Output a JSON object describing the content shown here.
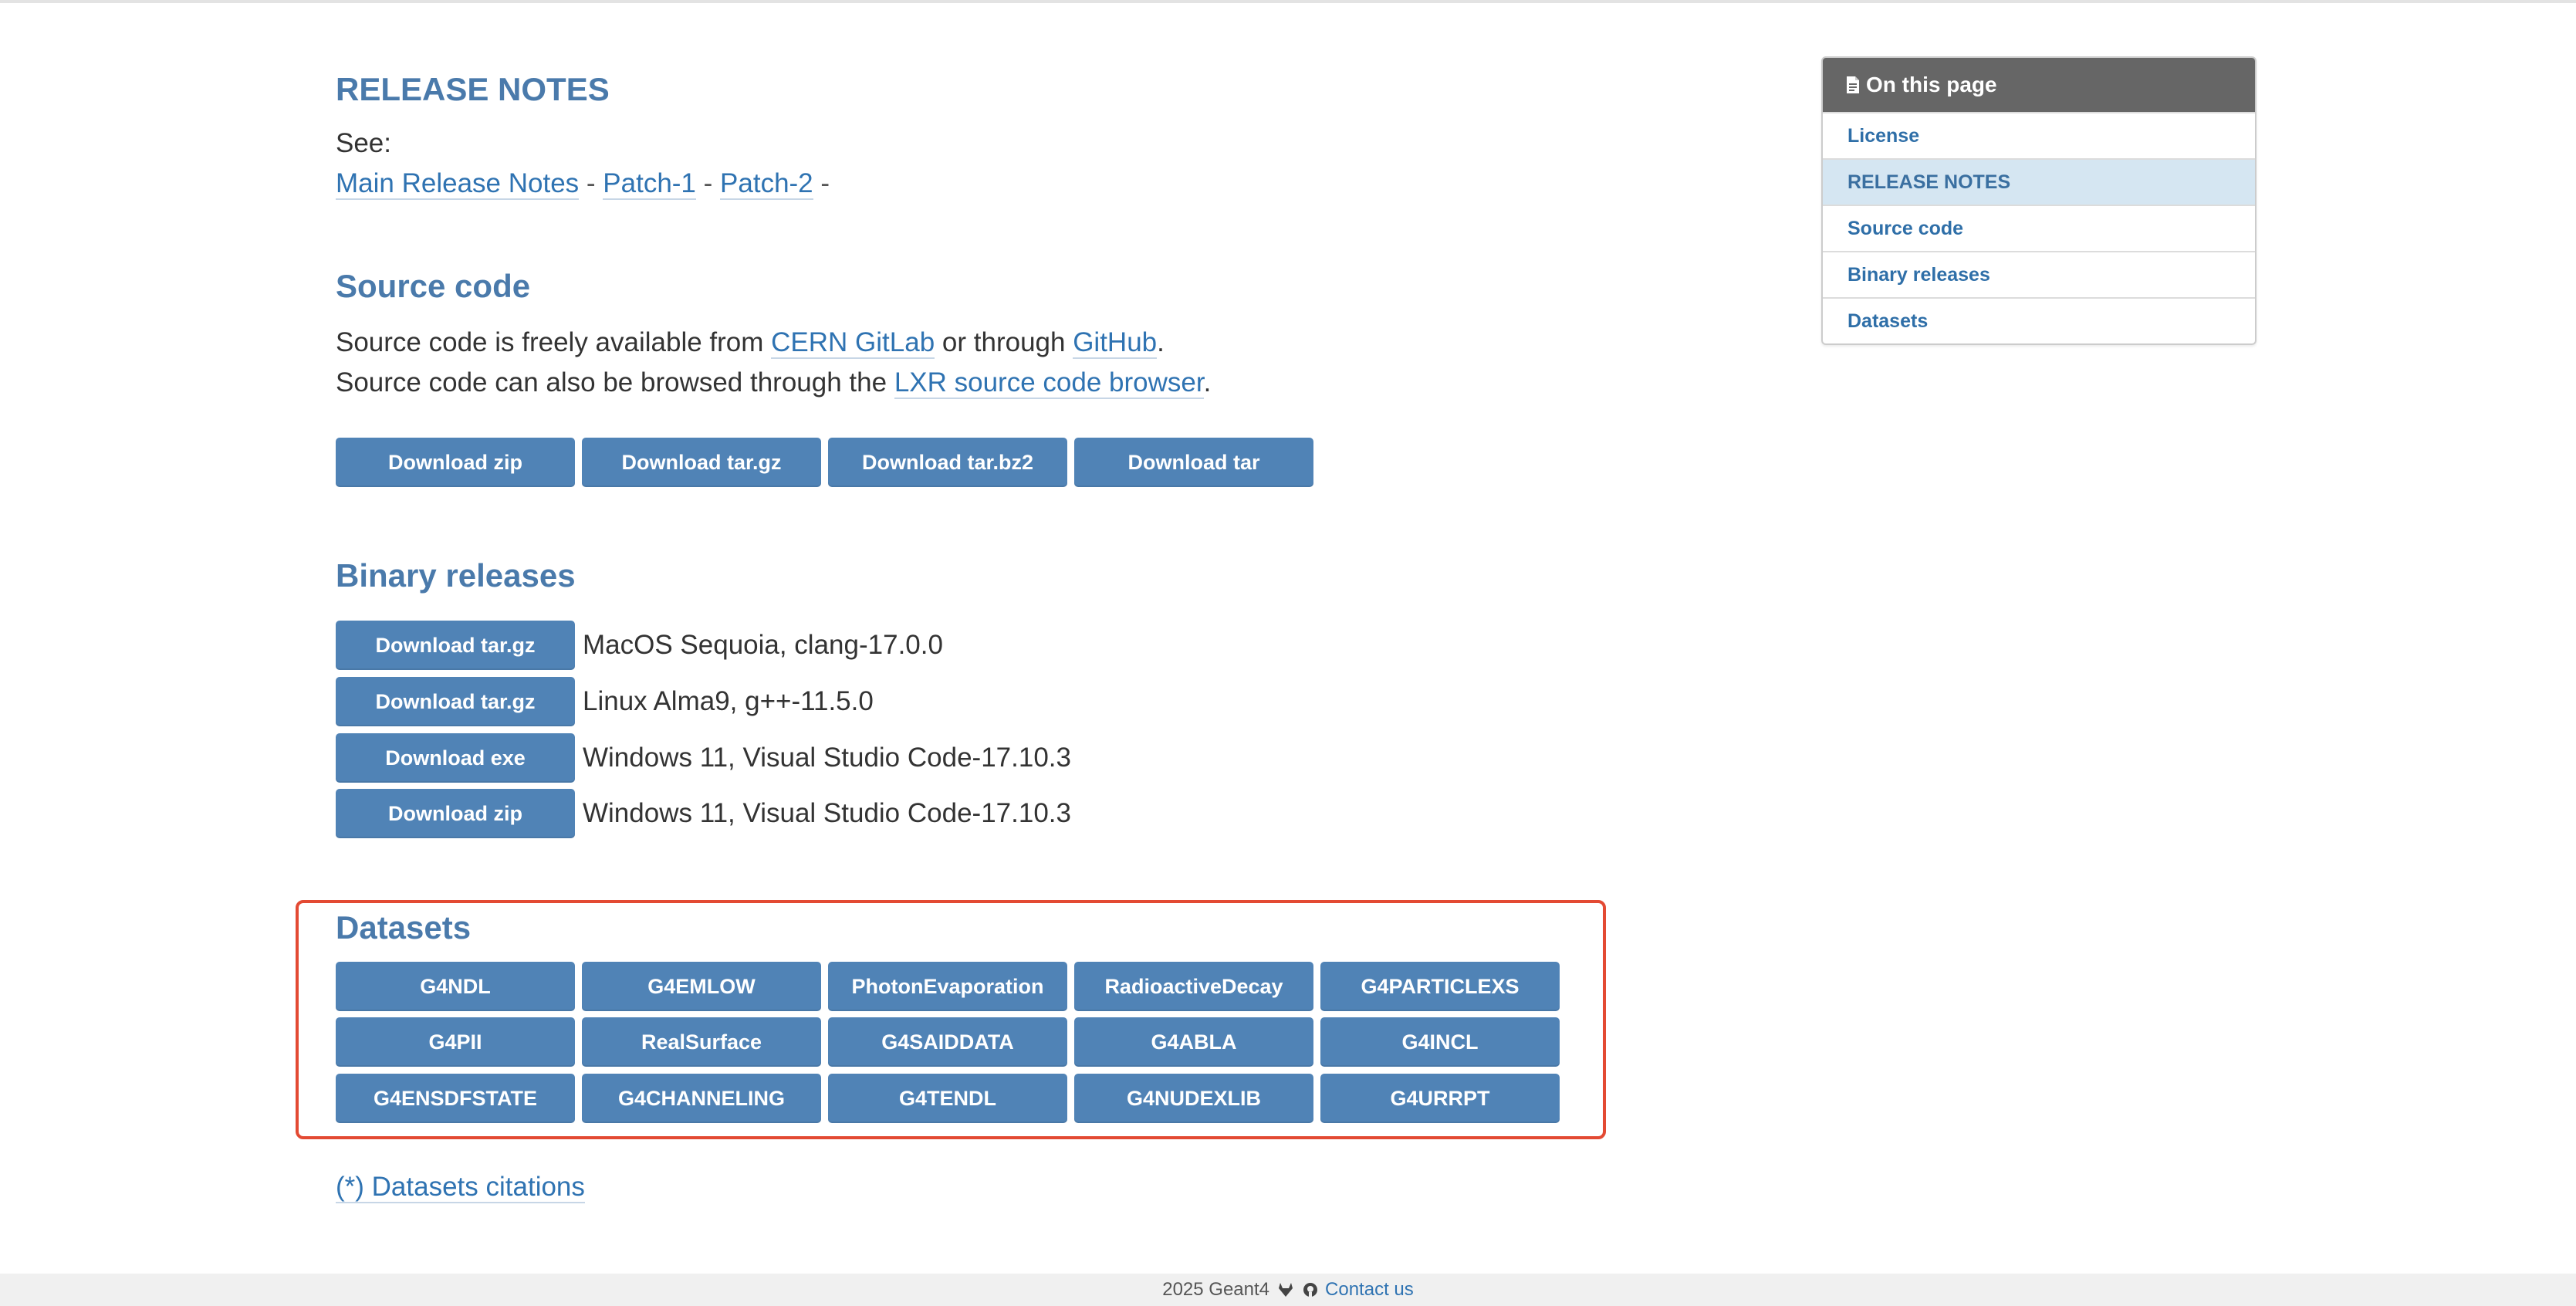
{
  "release_notes": {
    "heading": "RELEASE NOTES",
    "see_label": "See:",
    "links": [
      "Main Release Notes",
      "Patch-1",
      "Patch-2"
    ],
    "separator": "-"
  },
  "source_code": {
    "heading": "Source code",
    "line1_prefix": "Source code is freely available from ",
    "line1_link1": "CERN GitLab",
    "line1_mid": " or through ",
    "line1_link2": "GitHub",
    "line1_suffix": ".",
    "line2_prefix": "Source code can also be browsed through the ",
    "line2_link": "LXR source code browser",
    "line2_suffix": ".",
    "buttons": [
      "Download zip",
      "Download tar.gz",
      "Download tar.bz2",
      "Download tar"
    ]
  },
  "binary_releases": {
    "heading": "Binary releases",
    "rows": [
      {
        "button": "Download tar.gz",
        "label": "MacOS Sequoia, clang-17.0.0"
      },
      {
        "button": "Download tar.gz",
        "label": "Linux Alma9, g++-11.5.0"
      },
      {
        "button": "Download exe",
        "label": "Windows 11, Visual Studio Code-17.10.3"
      },
      {
        "button": "Download zip",
        "label": "Windows 11, Visual Studio Code-17.10.3"
      }
    ]
  },
  "datasets": {
    "heading": "Datasets",
    "buttons": [
      "G4NDL",
      "G4EMLOW",
      "PhotonEvaporation",
      "RadioactiveDecay",
      "G4PARTICLEXS",
      "G4PII",
      "RealSurface",
      "G4SAIDDATA",
      "G4ABLA",
      "G4INCL",
      "G4ENSDFSTATE",
      "G4CHANNELING",
      "G4TENDL",
      "G4NUDEXLIB",
      "G4URRPT"
    ],
    "citations_link": "(*) Datasets citations"
  },
  "toc": {
    "title": "On this page",
    "items": [
      "License",
      "RELEASE NOTES",
      "Source code",
      "Binary releases",
      "Datasets"
    ],
    "active": "RELEASE NOTES"
  },
  "footer": {
    "text": "2025 Geant4",
    "contact": "Contact us"
  },
  "colors": {
    "accent": "#4a7aab",
    "button": "#5083b6",
    "highlight": "#e34a33"
  }
}
